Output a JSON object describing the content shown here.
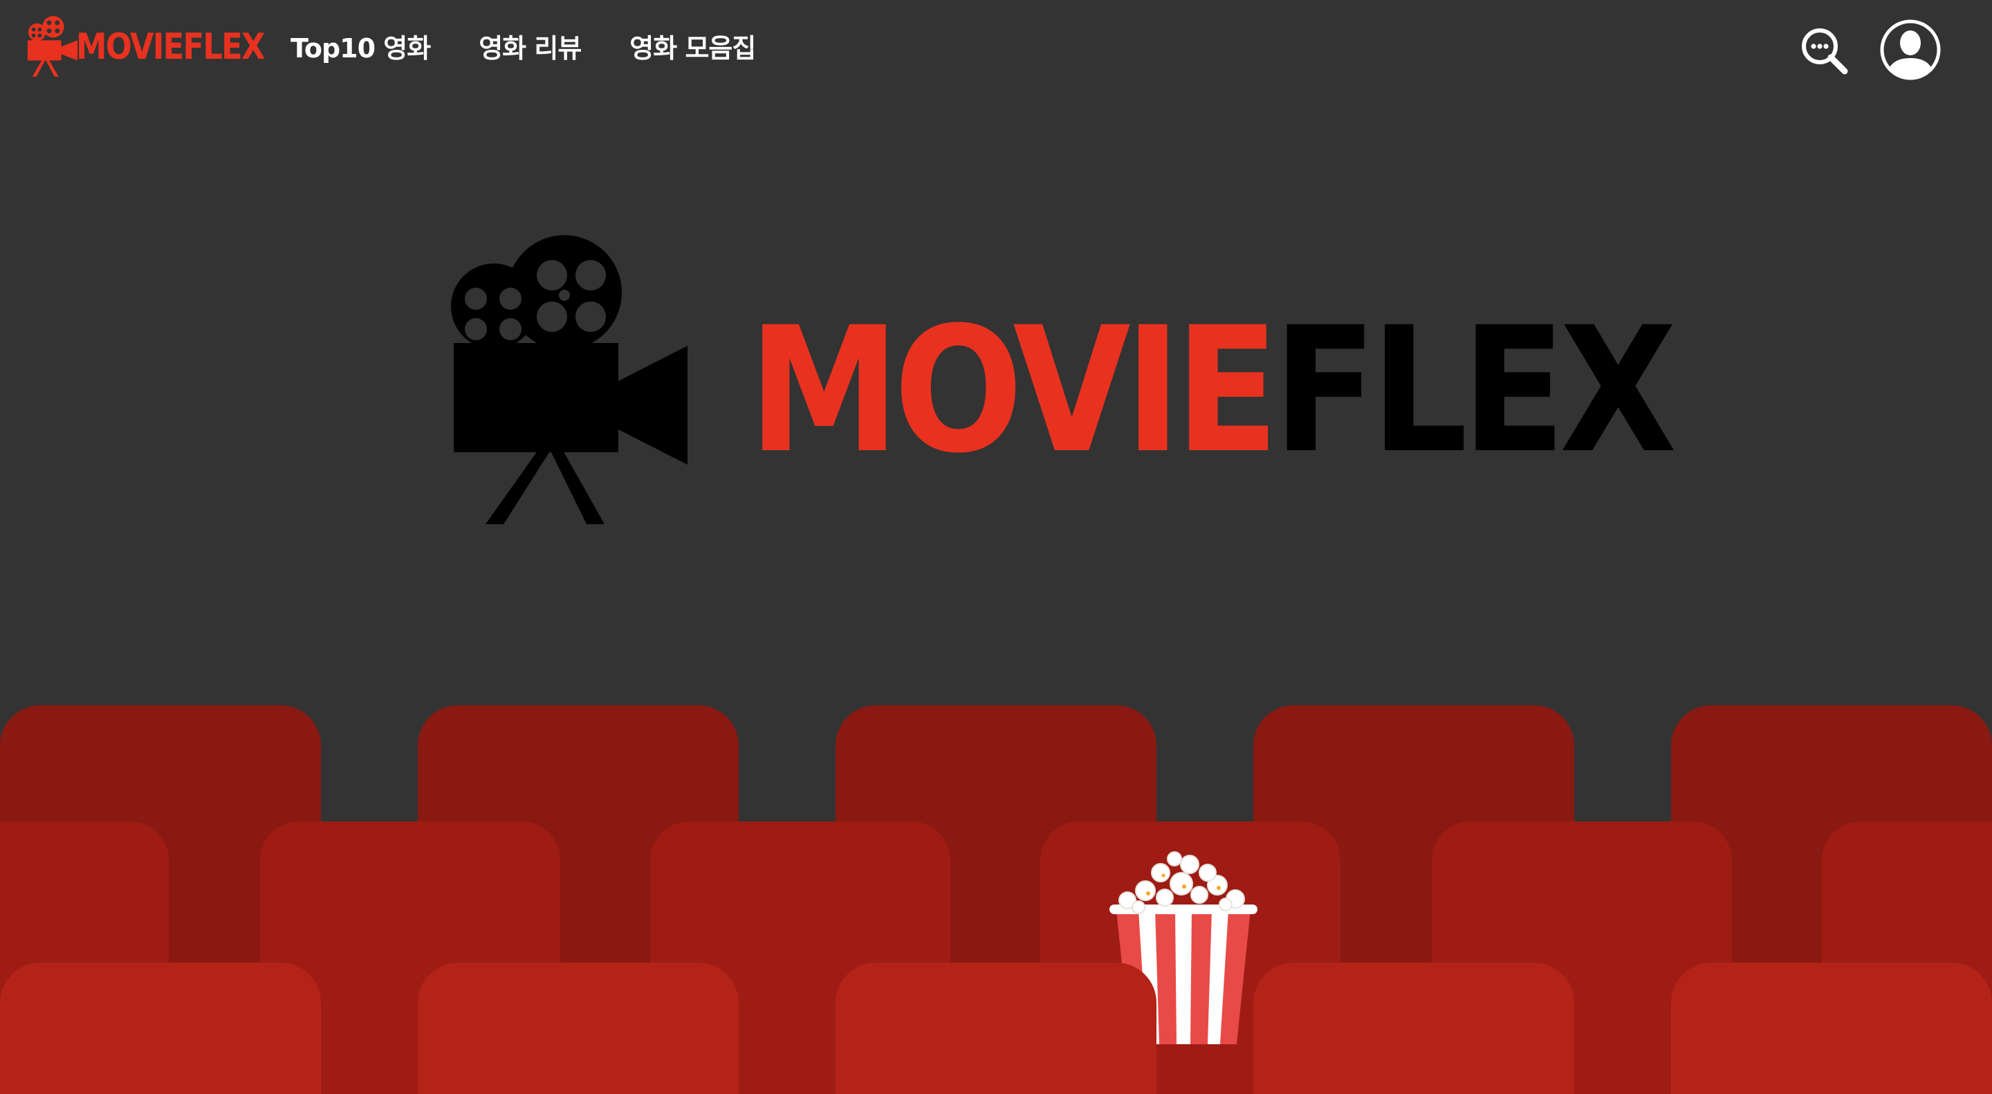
{
  "brand": {
    "name_red": "MOVIE",
    "name_flex": "FLEX",
    "colors": {
      "red": "#e8321f",
      "black": "#000000",
      "background": "#333333",
      "nav_text": "#ffffff"
    }
  },
  "nav": {
    "items": [
      {
        "label": "Top10 영화"
      },
      {
        "label": "영화 리뷰"
      },
      {
        "label": "영화 모음집"
      }
    ],
    "search_icon": "search-icon",
    "profile_icon": "user-avatar-icon"
  },
  "hero": {
    "word_red": "MOVIE",
    "word_black": "FLEX",
    "camera_icon": "film-camera-icon"
  },
  "scene": {
    "seat_colors": {
      "back": "#8a1912",
      "middle": "#9e1c14",
      "front": "#b32317"
    },
    "popcorn_icon": "popcorn-icon"
  }
}
